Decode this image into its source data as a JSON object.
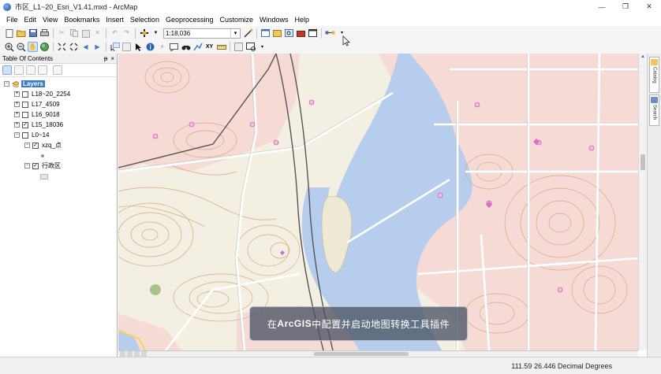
{
  "window": {
    "title": "市区_L1~20_Esri_V1.41.mxd - ArcMap",
    "controls": [
      "—",
      "❐",
      "✕"
    ]
  },
  "menu": {
    "items": [
      "File",
      "Edit",
      "View",
      "Bookmarks",
      "Insert",
      "Selection",
      "Geoprocessing",
      "Customize",
      "Windows",
      "Help"
    ]
  },
  "toolbar": {
    "scale_value": "1:18,036"
  },
  "toc": {
    "title": "Table Of Contents",
    "header_buttons": [
      "ᵽ",
      "×"
    ],
    "root_label": "Layers",
    "layers": [
      {
        "name": "L18~20_2254",
        "checked": false
      },
      {
        "name": "L17_4509",
        "checked": false
      },
      {
        "name": "L16_9018",
        "checked": false
      },
      {
        "name": "L15_18036",
        "checked": true
      },
      {
        "name": "L0~14",
        "checked": false
      },
      {
        "name": "xzq_点",
        "checked": true
      },
      {
        "name": "行政区",
        "checked": true
      }
    ]
  },
  "caption": {
    "prefix": "在",
    "highlight": "ArcGIS",
    "suffix": "中配置并启动地图转换工具插件"
  },
  "dock": {
    "tabs": [
      "Catalog",
      "Search"
    ]
  },
  "status": {
    "coordinates": "111.59  26.446 Decimal Degrees"
  },
  "colors": {
    "water": "#b6cdee",
    "land": "#f3efe3",
    "urban": "#f6dad6",
    "contour": "#d6ab76",
    "accent_blue": "#3a79c6"
  },
  "icons": [
    "app-globe-icon",
    "new-icon",
    "open-icon",
    "save-icon",
    "print-icon",
    "cut-icon",
    "copy-icon",
    "paste-icon",
    "delete-icon",
    "undo-icon",
    "redo-icon",
    "add-data-icon",
    "zoom-in-icon",
    "zoom-out-icon",
    "pan-icon",
    "full-extent-icon",
    "select-icon",
    "identify-icon",
    "find-icon",
    "measure-icon"
  ]
}
